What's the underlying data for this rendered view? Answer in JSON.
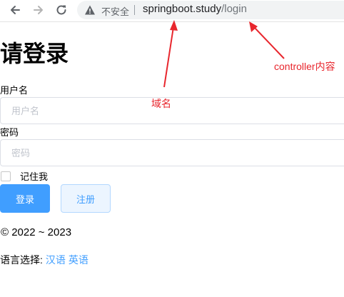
{
  "browser": {
    "back_icon": "arrow-left-icon",
    "forward_icon": "arrow-right-icon",
    "reload_icon": "reload-icon",
    "security_icon": "warning-triangle-icon",
    "security_text": "不安全",
    "url_host": "springboot.study",
    "url_path": "/login"
  },
  "page": {
    "title": "请登录",
    "username_label": "用户名",
    "username_placeholder": "用户名",
    "password_label": "密码",
    "password_placeholder": "密码",
    "remember_me": "记住我",
    "login_button": "登录",
    "register_button": "注册",
    "copyright": "© 2022 ~ 2023",
    "language_label": "语言选择:",
    "languages": [
      "汉语",
      "英语"
    ]
  },
  "annotations": {
    "domain_note": "域名",
    "controller_note": "controller内容"
  },
  "colors": {
    "annotation": "#e8262d",
    "primary": "#409eff"
  }
}
